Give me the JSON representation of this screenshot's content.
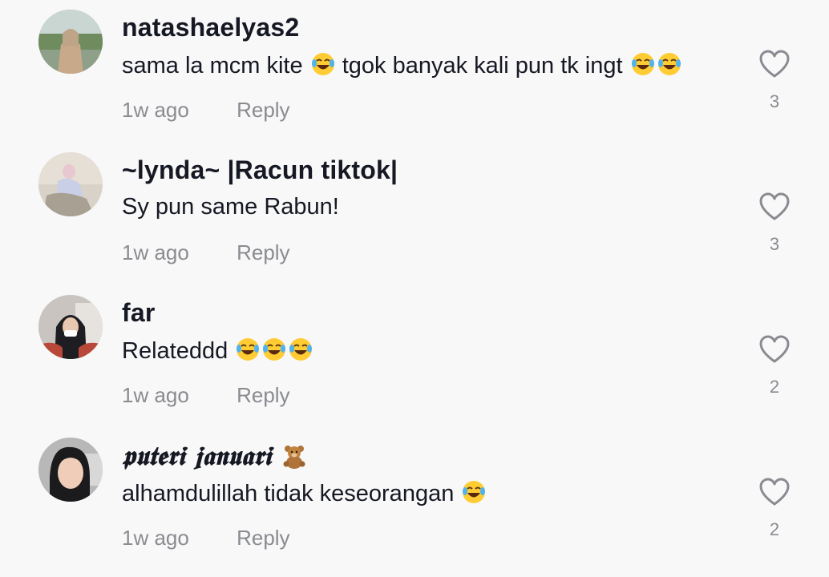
{
  "comments": [
    {
      "username": "natashaelyas2",
      "text": "sama la mcm kite",
      "text_emoji_mid": "tgok banyak kali pun tk ingt",
      "time": "1w ago",
      "reply": "Reply",
      "likes": "3",
      "emoji_name": "joy-emoji"
    },
    {
      "username": "~lynda~ |Racun tiktok|",
      "text": "Sy pun same Rabun!",
      "time": "1w ago",
      "reply": "Reply",
      "likes": "3"
    },
    {
      "username": "far",
      "text": "Relateddd",
      "time": "1w ago",
      "reply": "Reply",
      "likes": "2",
      "emoji_name": "joy-emoji"
    },
    {
      "username": "𝖕𝖚𝖙𝖊𝖗𝖎 𝖏𝖆𝖓𝖚𝖆𝖗𝖎",
      "username_emoji": "teddy-bear-emoji",
      "text": "alhamdulillah tidak keseorangan",
      "time": "1w ago",
      "reply": "Reply",
      "likes": "2",
      "emoji_name": "joy-emoji"
    }
  ],
  "icons": {
    "like": "heart-outline-icon"
  },
  "colors": {
    "background": "#f8f8f8",
    "username": "#161823",
    "secondary": "#8a8b91"
  }
}
